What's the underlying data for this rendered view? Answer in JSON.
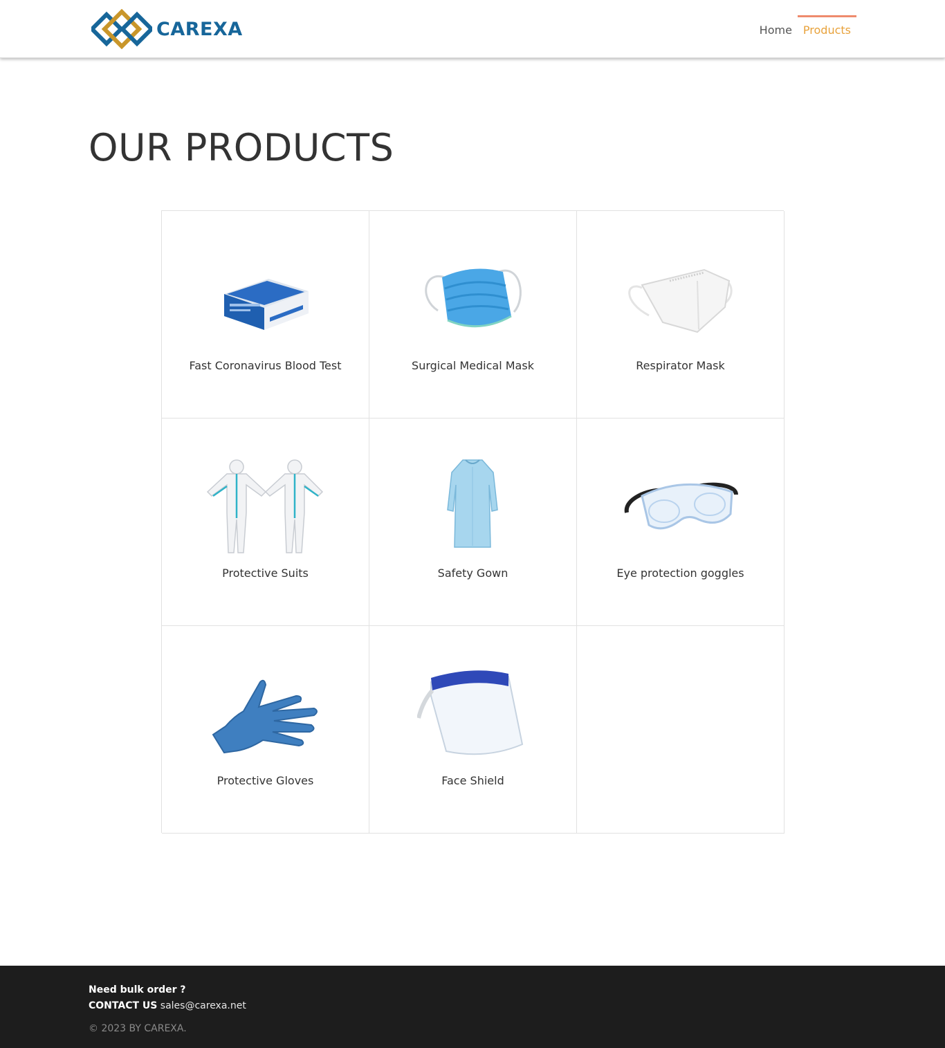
{
  "header": {
    "logo_text": "CAREXA",
    "nav": [
      {
        "label": "Home",
        "active": false
      },
      {
        "label": "Products",
        "active": true
      }
    ]
  },
  "main": {
    "title": "OUR PRODUCTS",
    "products": [
      {
        "name": "Fast Coronavirus Blood Test",
        "icon": "test-kit-box"
      },
      {
        "name": "Surgical Medical Mask",
        "icon": "surgical-mask"
      },
      {
        "name": "Respirator Mask",
        "icon": "respirator-mask"
      },
      {
        "name": "Protective Suits",
        "icon": "protective-suit"
      },
      {
        "name": "Safety Gown",
        "icon": "safety-gown"
      },
      {
        "name": "Eye protection goggles",
        "icon": "goggles"
      },
      {
        "name": "Protective Gloves",
        "icon": "glove"
      },
      {
        "name": "Face Shield",
        "icon": "face-shield"
      }
    ]
  },
  "footer": {
    "bulk_order": "Need bulk order ?",
    "contact_label": "CONTACT US",
    "email": "sales@carexa.net",
    "copyright": "© 2023 BY CAREXA."
  },
  "colors": {
    "brand_blue": "#17669a",
    "brand_gold": "#c9962a",
    "nav_active": "#e8a23b",
    "nav_active_bar": "#ee8b6d",
    "footer_bg": "#1d1d1d"
  }
}
